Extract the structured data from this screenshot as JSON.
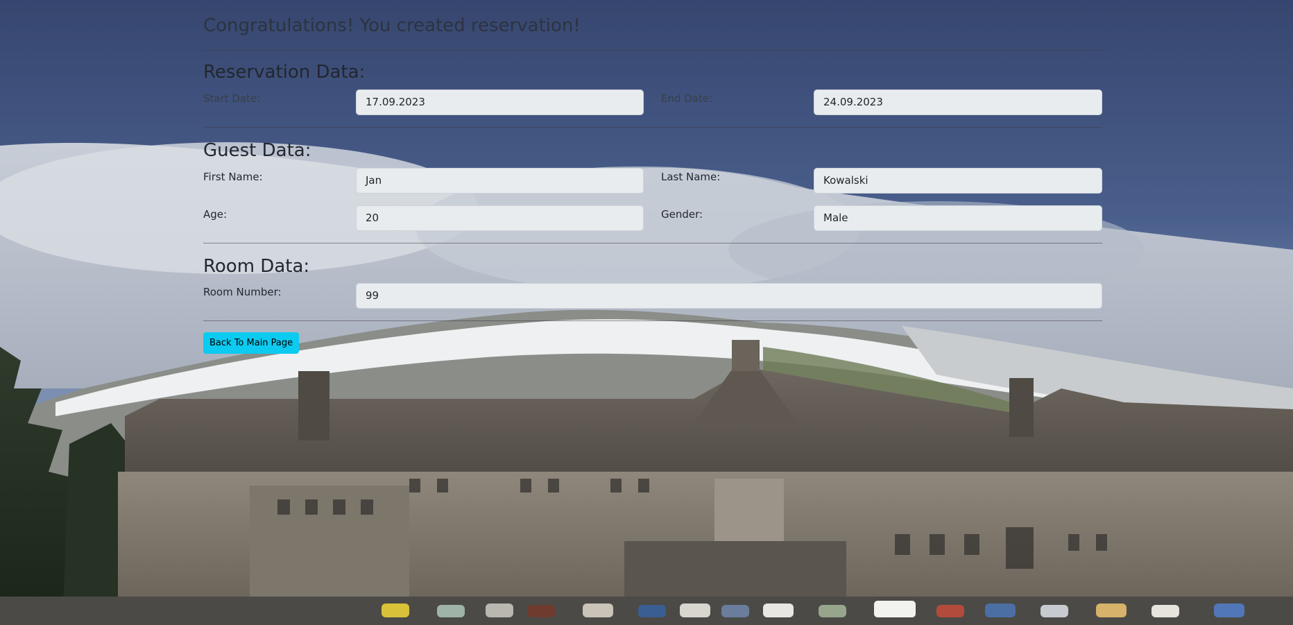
{
  "page_title": "Congratulations! You created reservation!",
  "reservation": {
    "title": "Reservation Data:",
    "start_label": "Start Date:",
    "start_value": "17.09.2023",
    "end_label": "End Date:",
    "end_value": "24.09.2023"
  },
  "guest": {
    "title": "Guest Data:",
    "first_name_label": "First Name:",
    "first_name_value": "Jan",
    "last_name_label": "Last Name:",
    "last_name_value": "Kowalski",
    "age_label": "Age:",
    "age_value": "20",
    "gender_label": "Gender:",
    "gender_value": "Male"
  },
  "room": {
    "title": "Room Data:",
    "number_label": "Room Number:",
    "number_value": "99"
  },
  "actions": {
    "back_label": "Back To Main Page"
  },
  "colors": {
    "button": "#0dcaf0",
    "field_bg": "#e9ecef",
    "sky": "#3f5482"
  }
}
